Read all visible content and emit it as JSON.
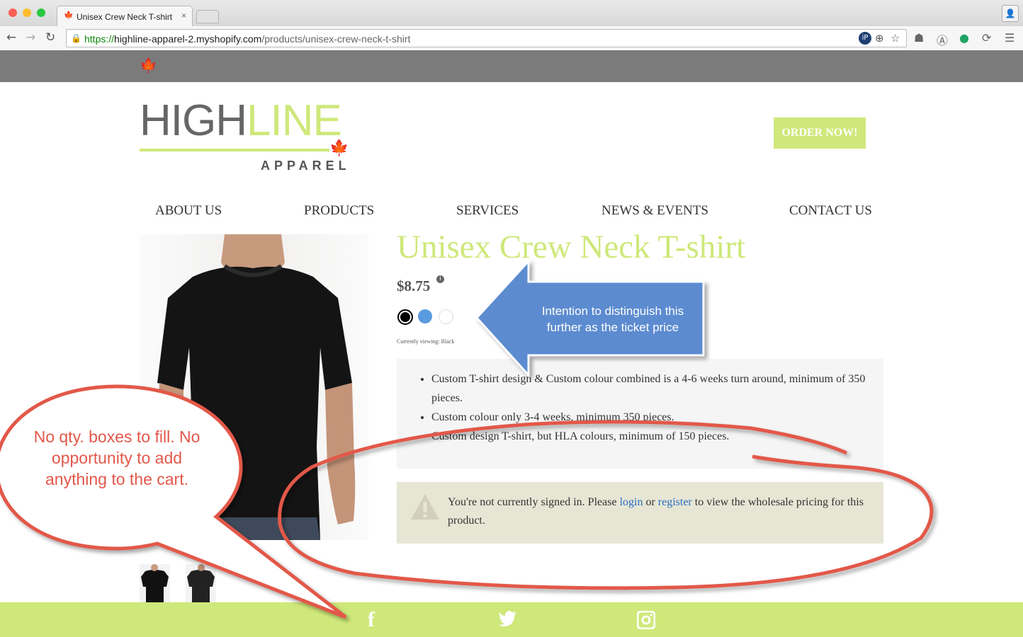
{
  "browser": {
    "tab_title": "Unisex Crew Neck T-shirt",
    "tab_close": "×",
    "url_scheme": "https://",
    "url_host": "highline-apparel-2.myshopify.com",
    "url_path": "/products/unisex-crew-neck-t-shirt"
  },
  "site": {
    "logo_high": "HIGH",
    "logo_line": "LINE",
    "logo_apparel": "APPAREL",
    "order_button": "ORDER NOW!",
    "nav": [
      "ABOUT US",
      "PRODUCTS",
      "SERVICES",
      "NEWS & EVENTS",
      "CONTACT US"
    ]
  },
  "product": {
    "title": "Unisex Crew Neck T-shirt",
    "price": "$8.75",
    "info": "i",
    "swatches": [
      {
        "name": "Black",
        "color": "#000000"
      },
      {
        "name": "Blue",
        "color": "#5a9be0"
      },
      {
        "name": "White",
        "color": "#ffffff"
      }
    ],
    "currently_viewing": "Currently viewing: Black",
    "details": [
      "Custom T-shirt design & Custom colour combined is a 4-6 weeks turn around, minimum of 350 pieces.",
      "Custom colour only 3-4 weeks, minimum 350 pieces.",
      "Custom design T-shirt, but HLA colours, minimum of 150 pieces."
    ],
    "notice_before": "You're not currently signed in. Please ",
    "notice_login": "login",
    "notice_or": " or ",
    "notice_register": "register",
    "notice_after": " to view the wholesale pricing for this product."
  },
  "footer": {
    "icons": [
      "facebook-icon",
      "twitter-icon",
      "instagram-icon"
    ]
  },
  "annotations": {
    "arrow_text": "Intention to distinguish this further as the ticket price",
    "bubble_text": "No qty. boxes to fill. No opportunity to add anything to the cart."
  },
  "colors": {
    "brand_green": "#cfe87a",
    "annotation_red": "#e2584a",
    "annotation_blue": "#5b8bd0"
  }
}
